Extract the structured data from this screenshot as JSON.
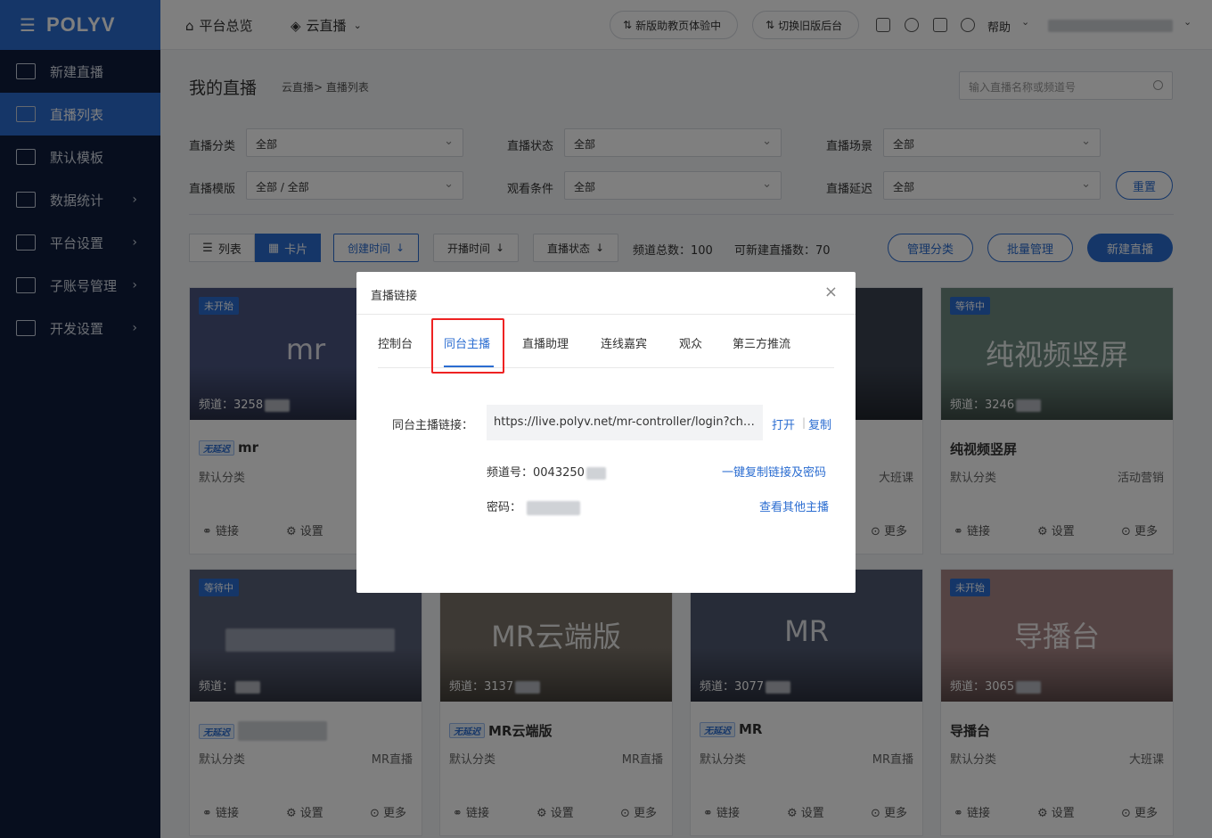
{
  "sidebar": {
    "brand": "POLYV",
    "items": [
      {
        "label": "新建直播",
        "icon": "video-icon"
      },
      {
        "label": "直播列表",
        "icon": "list-icon",
        "active": true
      },
      {
        "label": "默认模板",
        "icon": "template-icon"
      },
      {
        "label": "数据统计",
        "icon": "chart-icon",
        "arrow": "›"
      },
      {
        "label": "平台设置",
        "icon": "layers-icon",
        "arrow": "›"
      },
      {
        "label": "子账号管理",
        "icon": "id-card-icon",
        "arrow": "›"
      },
      {
        "label": "开发设置",
        "icon": "code-icon",
        "arrow": "›"
      }
    ]
  },
  "topbar": {
    "overview": "平台总览",
    "cloud_live": "云直播",
    "new_assistant": "新版助教页体验中",
    "switch_old": "切换旧版后台",
    "help": "帮助"
  },
  "header": {
    "title": "我的直播",
    "breadcrumb": "云直播> 直播列表",
    "search_placeholder": "输入直播名称或频道号"
  },
  "filters": [
    {
      "label": "直播分类",
      "value": "全部"
    },
    {
      "label": "直播状态",
      "value": "全部"
    },
    {
      "label": "直播场景",
      "value": "全部"
    },
    {
      "label": "直播模版",
      "value": "全部 / 全部"
    },
    {
      "label": "观看条件",
      "value": "全部"
    },
    {
      "label": "直播延迟",
      "value": "全部"
    }
  ],
  "reset": "重置",
  "toolbar": {
    "list": "列表",
    "card": "卡片",
    "sort_create": "创建时间",
    "sort_start": "开播时间",
    "sort_status": "直播状态",
    "total": "频道总数：100",
    "available": "可新建直播数：70",
    "manage_category": "管理分类",
    "batch": "批量管理",
    "new_live": "新建直播"
  },
  "cards": [
    {
      "badge": "未开始",
      "big": "mr",
      "channel": "频道：3258",
      "name": "mr",
      "category": "默认分类",
      "tag": "",
      "color": "#4a5580"
    },
    {
      "badge": "",
      "big": "",
      "channel": "",
      "name": "",
      "category": "",
      "tag": "",
      "color": "#5a5a60"
    },
    {
      "badge": "",
      "big": "",
      "channel": "",
      "name": "",
      "category": "",
      "tag": "大班课",
      "color": "#3a4250"
    },
    {
      "badge": "等待中",
      "big": "纯视频竖屏",
      "channel": "频道：3246",
      "name": "纯视频竖屏",
      "category": "默认分类",
      "tag": "活动营销",
      "color": "#6f8a80"
    },
    {
      "badge": "等待中",
      "big": "",
      "channel": "频道：",
      "name": "",
      "category": "默认分类",
      "tag": "MR直播",
      "color": "#596078"
    },
    {
      "badge": "",
      "big": "MR云端版",
      "channel": "频道：3137",
      "name": "MR云端版",
      "category": "默认分类",
      "tag": "MR直播",
      "color": "#7a7268"
    },
    {
      "badge": "",
      "big": "MR",
      "channel": "频道：3077",
      "name": "MR",
      "category": "默认分类",
      "tag": "MR直播",
      "color": "#4f5870"
    },
    {
      "badge": "未开始",
      "big": "导播台",
      "channel": "频道：3065",
      "name": "导播台",
      "category": "默认分类",
      "tag": "大班课",
      "color": "#a88686"
    }
  ],
  "card_actions": {
    "link": "链接",
    "settings": "设置",
    "more": "更多"
  },
  "low_latency": "无延迟",
  "modal": {
    "title": "直播链接",
    "close": "×",
    "tabs": [
      "控制台",
      "同台主播",
      "直播助理",
      "连线嘉宾",
      "观众",
      "第三方推流"
    ],
    "active_tab": 1,
    "link_label": "同台主播链接：",
    "url": "https://live.polyv.net/mr-controller/login?channelId=...",
    "open": "打开",
    "copy": "复制",
    "channel_label": "频道号：0043250",
    "password_label": "密码：",
    "copy_all": "一键复制链接及密码",
    "view_others": "查看其他主播"
  },
  "colors": {
    "primary": "#2b6dd1",
    "sidebar": "#0f1d3c",
    "highlight": "#e22222"
  }
}
